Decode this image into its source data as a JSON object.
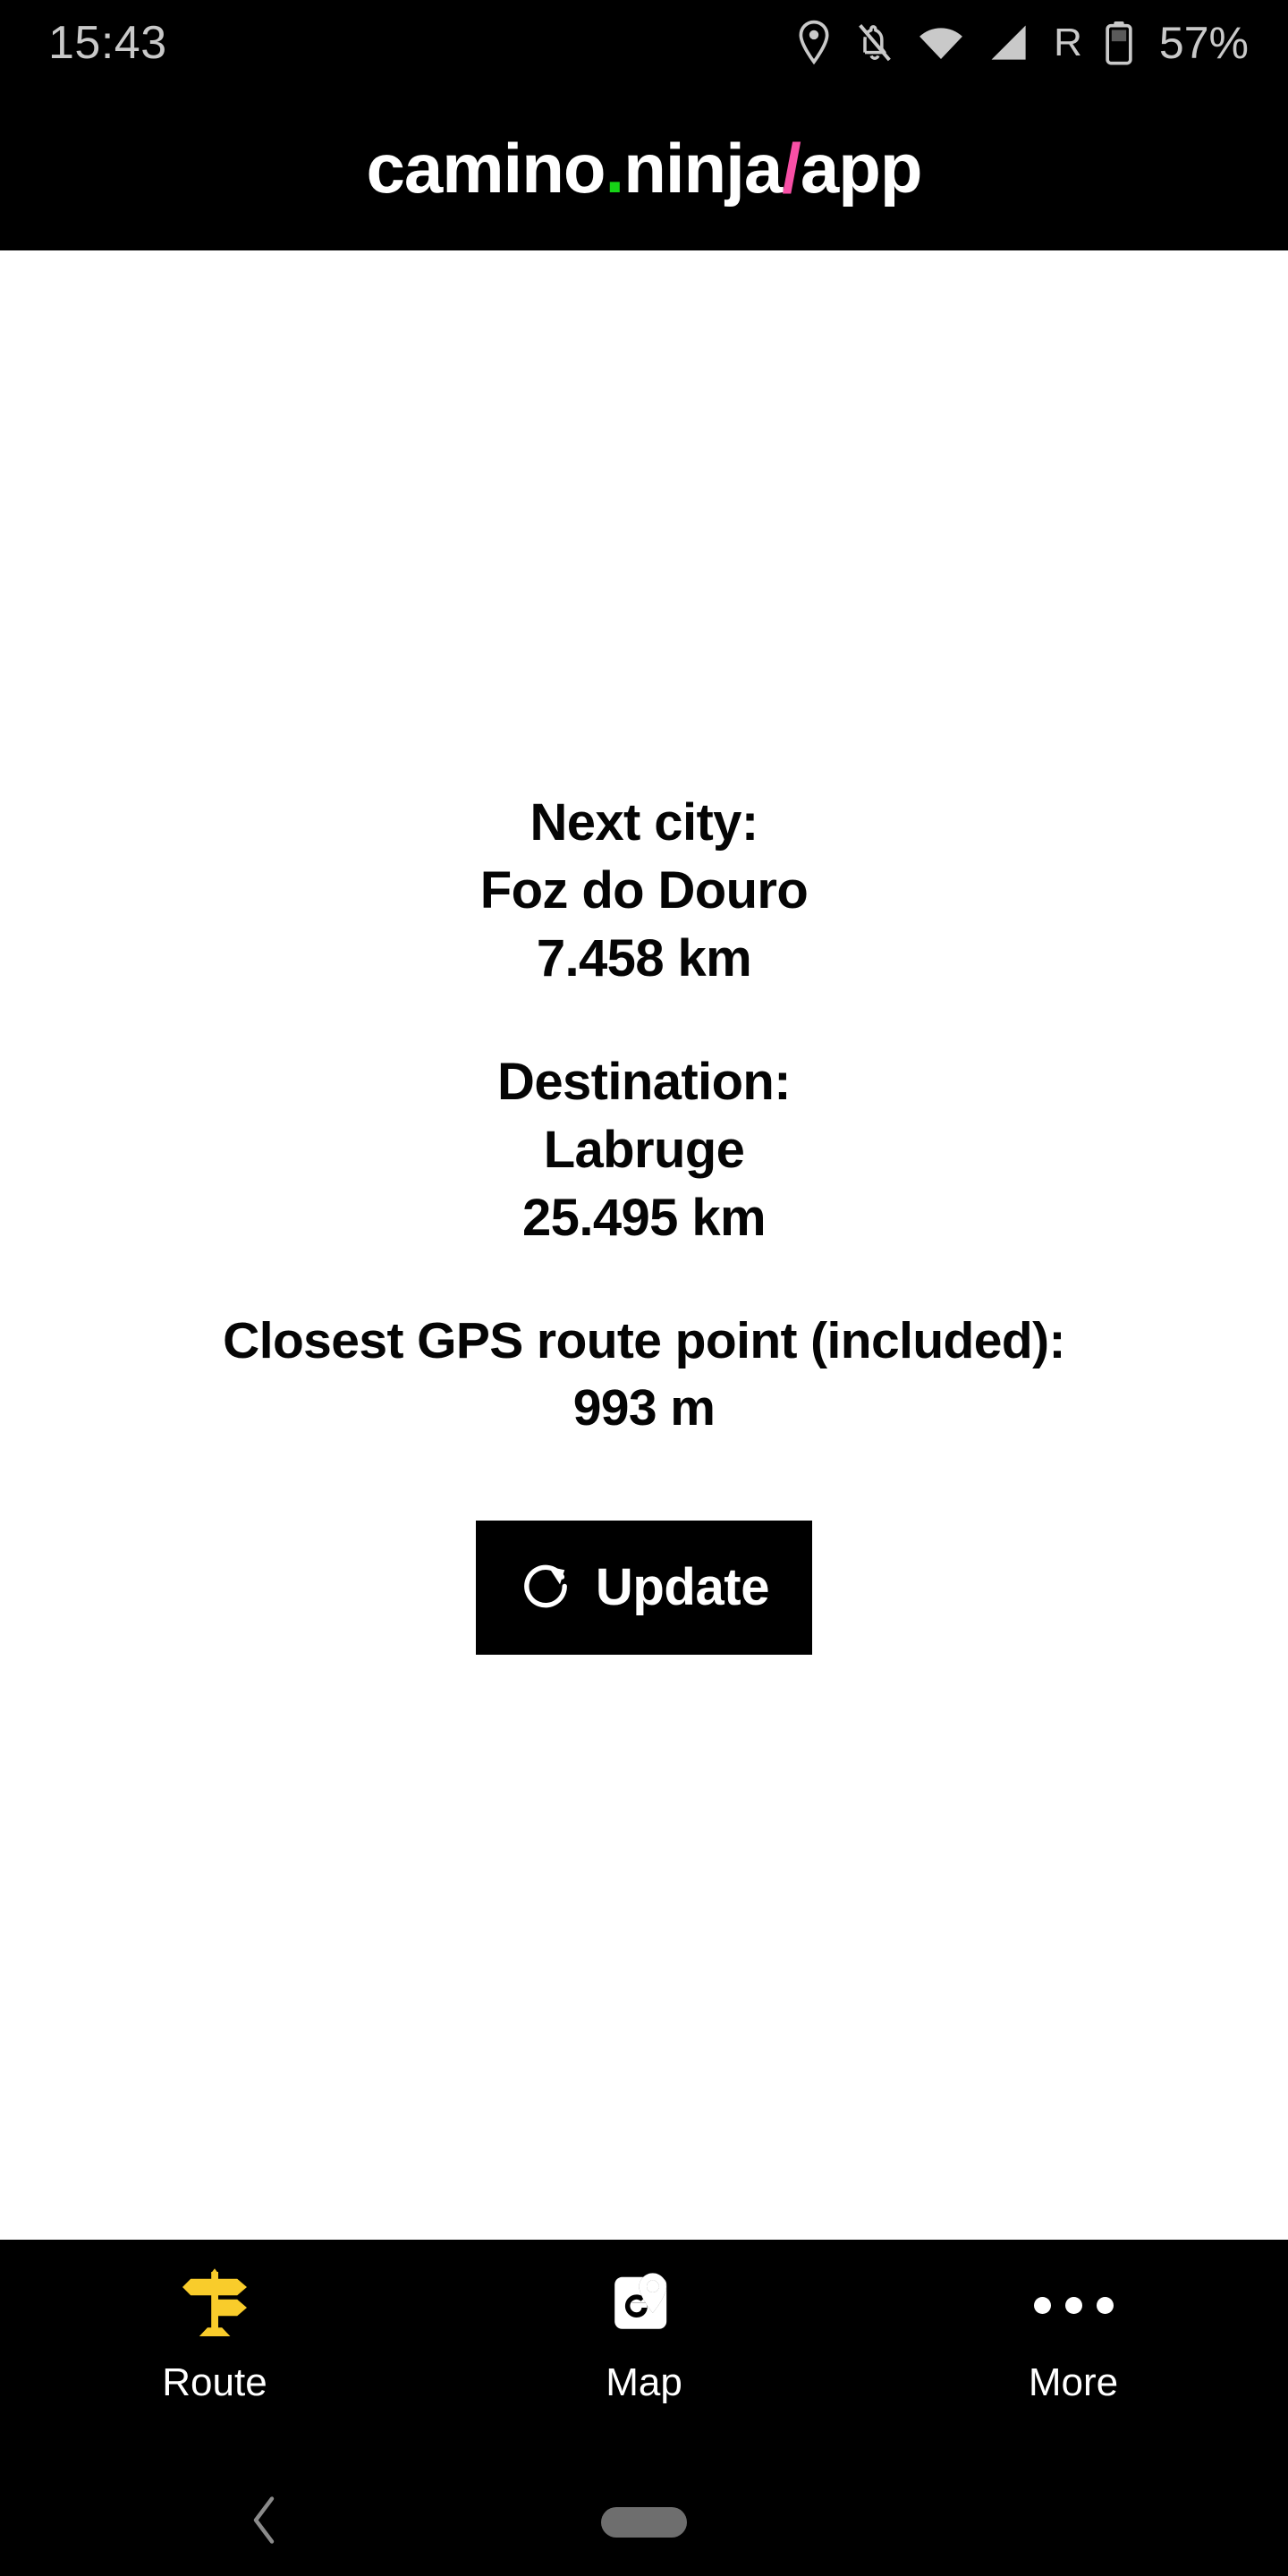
{
  "status_bar": {
    "time": "15:43",
    "battery_percent": "57%",
    "roaming_label": "R",
    "icons": [
      "location-icon",
      "notifications-off-icon",
      "wifi-icon",
      "signal-icon",
      "roaming-icon",
      "battery-icon"
    ]
  },
  "header": {
    "title_part1": "camino",
    "title_dot": ".",
    "title_part2": "ninja",
    "title_slash": "/",
    "title_part3": "app",
    "full_title": "camino.ninja/app",
    "dot_color": "#16d416",
    "slash_color": "#f84fa6",
    "background": "#000000"
  },
  "main": {
    "next_city": {
      "label": "Next city:",
      "name": "Foz do Douro",
      "distance": "7.458 km"
    },
    "destination": {
      "label": "Destination:",
      "name": "Labruge",
      "distance": "25.495 km"
    },
    "closest_point": {
      "label": "Closest GPS route point (included):",
      "distance": "993 m"
    },
    "update_button": {
      "label": "Update",
      "icon": "refresh-icon",
      "background": "#000000",
      "text_color": "#ffffff"
    }
  },
  "tab_bar": {
    "background": "#000000",
    "active_tab": "Route",
    "tabs": [
      {
        "label": "Route",
        "icon": "signpost-icon",
        "icon_color": "#f9cc2b",
        "active": true
      },
      {
        "label": "Map",
        "icon": "google-maps-icon",
        "icon_color": "#ffffff",
        "active": false
      },
      {
        "label": "More",
        "icon": "ellipsis-icon",
        "icon_color": "#ffffff",
        "active": false
      }
    ]
  },
  "system_nav": {
    "back": "back-chevron-icon",
    "home": "home-pill-indicator"
  }
}
